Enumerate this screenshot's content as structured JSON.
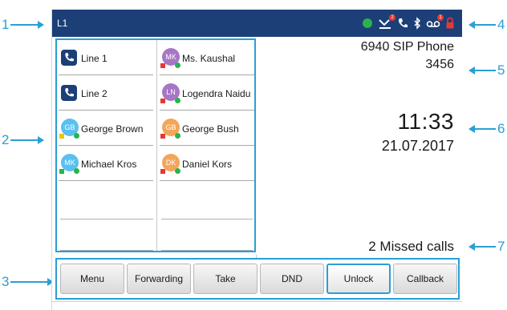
{
  "callouts": [
    "1",
    "2",
    "3",
    "4",
    "5",
    "6",
    "7"
  ],
  "status_bar": {
    "line_label": "L1",
    "icons": [
      "presence-available-icon",
      "missed-call-icon",
      "call-icon",
      "bluetooth-icon",
      "voicemail-icon",
      "lock-icon"
    ],
    "colors": {
      "background": "#1c3f78",
      "presence": "#2bb24c",
      "badge": "#e53935",
      "lock": "#e53935"
    }
  },
  "line_keys": {
    "left": [
      {
        "label": "Line 1",
        "type": "line"
      },
      {
        "label": "Line 2",
        "type": "line"
      },
      {
        "label": "George Brown",
        "type": "contact",
        "initials": "GB",
        "avatar_color": "#5bc0f0",
        "presence": "#f2c500"
      },
      {
        "label": "Michael Kros",
        "type": "contact",
        "initials": "MK",
        "avatar_color": "#5bc0f0",
        "presence": "#2bb24c"
      }
    ],
    "right": [
      {
        "label": "Ms. Kaushal",
        "type": "contact",
        "initials": "MK",
        "avatar_color": "#a876c6",
        "presence": "#e53935"
      },
      {
        "label": "Logendra Naidu",
        "type": "contact",
        "initials": "LN",
        "avatar_color": "#a876c6",
        "presence": "#e53935"
      },
      {
        "label": "George Bush",
        "type": "contact",
        "initials": "GB",
        "avatar_color": "#f2a65a",
        "presence": "#e53935"
      },
      {
        "label": "Daniel Kors",
        "type": "contact",
        "initials": "DK",
        "avatar_color": "#f2a65a",
        "presence": "#e53935"
      }
    ]
  },
  "info": {
    "model": "6940 SIP Phone",
    "extension": "3456",
    "time": "11:33",
    "date": "21.07.2017",
    "missed_calls": "2 Missed calls"
  },
  "softkeys": [
    {
      "label": "Menu",
      "selected": false
    },
    {
      "label": "Forwarding",
      "selected": false
    },
    {
      "label": "Take",
      "selected": false
    },
    {
      "label": "DND",
      "selected": false
    },
    {
      "label": "Unlock",
      "selected": true
    },
    {
      "label": "Callback",
      "selected": false
    }
  ],
  "accent_color": "#2a9fd6"
}
